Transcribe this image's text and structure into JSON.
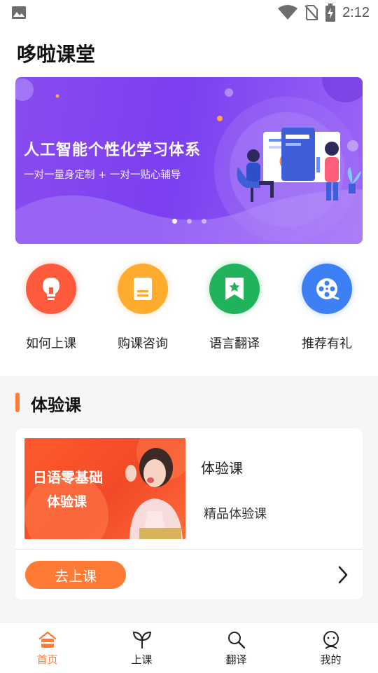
{
  "status_bar": {
    "time": "2:12",
    "icons": [
      "gallery-icon",
      "wifi-icon",
      "no-sim-icon",
      "battery-charging-icon"
    ]
  },
  "app": {
    "title": "哆啦课堂"
  },
  "banner": {
    "title": "人工智能个性化学习体系",
    "subtitle": "一对一量身定制 + 一对一贴心辅导",
    "page_count": 3,
    "active_index": 0,
    "colors": {
      "start": "#8a4bf0",
      "end": "#9a66f7"
    }
  },
  "quick_menu": [
    {
      "label": "如何上课",
      "icon": "lightbulb-icon",
      "color": "#ff5a3c"
    },
    {
      "label": "购课咨询",
      "icon": "book-icon",
      "color": "#ffab2e"
    },
    {
      "label": "语言翻译",
      "icon": "bookmark-star-icon",
      "color": "#21b25c"
    },
    {
      "label": "推荐有礼",
      "icon": "film-reel-icon",
      "color": "#3d7ff5"
    }
  ],
  "section": {
    "title": "体验课",
    "accent": "#ff7a35"
  },
  "course": {
    "image_line1": "日语零基础",
    "image_line2": "体验课",
    "name": "体验课",
    "description": "精品体验课",
    "button_label": "去上课"
  },
  "bottom_nav": [
    {
      "label": "首页",
      "icon": "home-icon",
      "active": true
    },
    {
      "label": "上课",
      "icon": "sprout-icon",
      "active": false
    },
    {
      "label": "翻译",
      "icon": "search-translate-icon",
      "active": false
    },
    {
      "label": "我的",
      "icon": "profile-face-icon",
      "active": false
    }
  ]
}
